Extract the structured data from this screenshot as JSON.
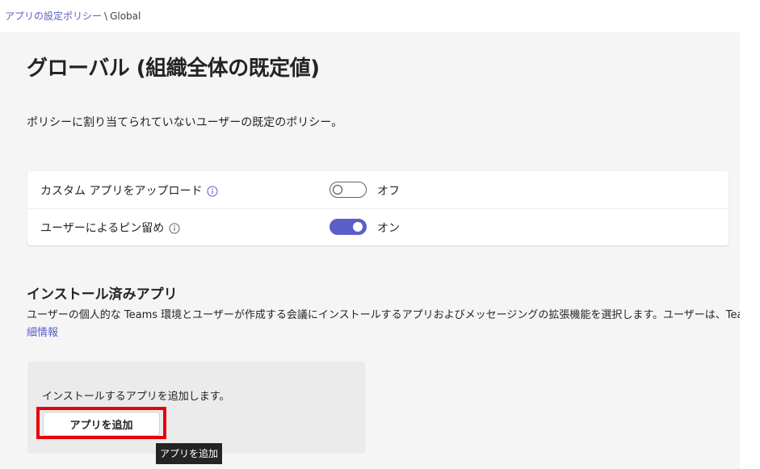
{
  "breadcrumb": {
    "parent": "アプリの設定ポリシー",
    "separator": "\\",
    "current": "Global"
  },
  "page": {
    "title": "グローバル (組織全体の既定値)",
    "description": "ポリシーに割り当てられていないユーザーの既定のポリシー。"
  },
  "settings": [
    {
      "label": "カスタム アプリをアップロード",
      "state": "オフ",
      "enabled": false
    },
    {
      "label": "ユーザーによるピン留め",
      "state": "オン",
      "enabled": true
    }
  ],
  "installed_apps": {
    "title": "インストール済みアプリ",
    "description": "ユーザーの個人的な Teams 環境とユーザーが作成する会議にインストールするアプリおよびメッセージングの拡張機能を選択します。ユーザーは、Team",
    "more_link": "細情報",
    "panel_text": "インストールするアプリを追加します。",
    "add_button": "アプリを追加",
    "tooltip": "アプリを追加"
  },
  "colors": {
    "accent": "#5b5fc7",
    "highlight": "#e8000b",
    "tooltip_bg": "#242424"
  },
  "icons": {
    "info": "info-icon"
  }
}
